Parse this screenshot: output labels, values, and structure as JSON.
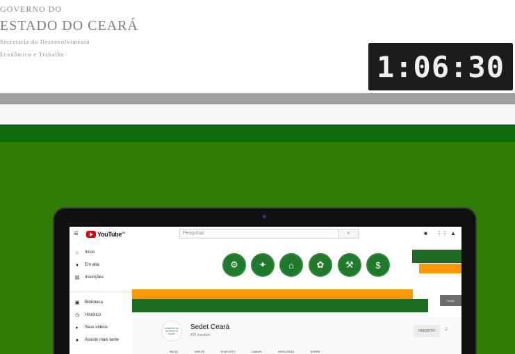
{
  "header": {
    "logo_lines": [
      "GOVERNO DO",
      "ESTADO DO CEARÁ",
      "Secretaria do Desenvolvimento",
      "Econômico e Trabalho"
    ],
    "timer": "1:06:30"
  },
  "youtube": {
    "brand": "YouTube",
    "brand_sup": "BR",
    "search_placeholder": "Pesquisar",
    "sidebar": [
      {
        "icon": "home-icon",
        "glyph": "⌂",
        "label": "Início"
      },
      {
        "icon": "trending-icon",
        "glyph": "🔥",
        "label": "Em alta"
      },
      {
        "icon": "subscriptions-icon",
        "glyph": "▤",
        "label": "Inscrições"
      },
      {
        "icon": "library-icon",
        "glyph": "▣",
        "label": "Biblioteca"
      },
      {
        "icon": "history-icon",
        "glyph": "◷",
        "label": "Histórico"
      },
      {
        "icon": "your-videos-icon",
        "glyph": "▶",
        "label": "Seus vídeos"
      },
      {
        "icon": "watch-later-icon",
        "glyph": "◔",
        "label": "Assistir mais tarde"
      }
    ],
    "banner": {
      "sedet_tag": "Sedet",
      "icons": [
        "industry-icon",
        "innovation-icon",
        "energy-icon",
        "agriculture-icon",
        "mining-icon",
        "finance-icon"
      ]
    },
    "channel": {
      "name": "Sedet Ceará",
      "subscribers": "415 inscritos",
      "avatar_text": "GOVERNO DO ESTADO DO CEARÁ",
      "subscribe_label": "INSCRITO",
      "tabs": [
        "INÍCIO",
        "VÍDEOS",
        "PLAYLISTS",
        "CANAIS",
        "DISCUSSÃO",
        "SOBRE"
      ]
    }
  },
  "colors": {
    "stage_green": "#2f7d06",
    "dark_green": "#0c6b0a",
    "brand_green": "#1c6b20",
    "brand_orange": "#ff9800"
  }
}
